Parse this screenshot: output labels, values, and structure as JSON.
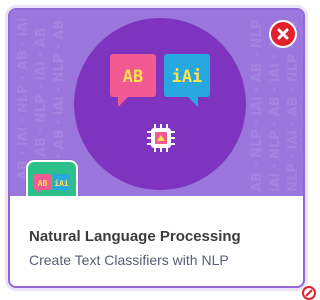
{
  "card": {
    "title": "Natural Language Processing",
    "subtitle": "Create Text Classifiers with NLP",
    "banner_color": "#9a76dd",
    "circle_color": "#7f34bf",
    "close_button_color": "#e0222d",
    "thumbnail_color": "#2ec08a",
    "title_color": "#3d3d3d",
    "subtitle_color": "#575e75"
  },
  "hero": {
    "left_bubble_text": "AB",
    "right_bubble_text": "iAi",
    "left_bubble_color": "#f15a93",
    "right_bubble_color": "#27a8e0",
    "chip_icon": "microchip-icon"
  },
  "thumbnail": {
    "left_bubble_text": "AB",
    "right_bubble_text": "iAi"
  },
  "icons": {
    "close": "close-icon",
    "corner": "close-icon"
  }
}
